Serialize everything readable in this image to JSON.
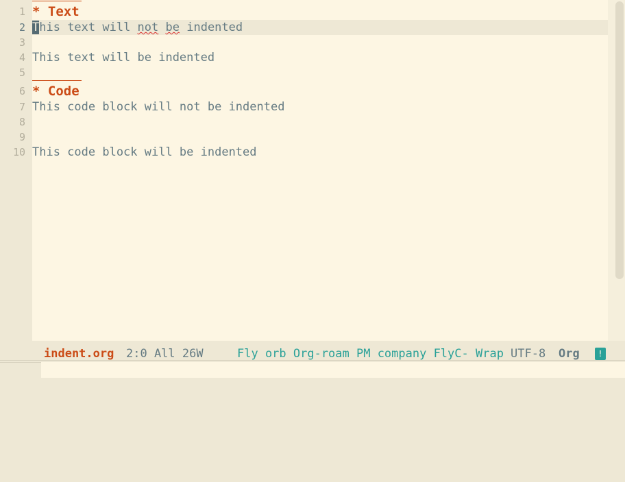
{
  "editor": {
    "lines": [
      {
        "num": "1",
        "text": "* Text",
        "kind": "heading"
      },
      {
        "num": "2",
        "cursor_char": "T",
        "segments": [
          "his text will ",
          "not",
          " ",
          "be",
          " indented"
        ],
        "kind": "current"
      },
      {
        "num": "3",
        "text": "",
        "kind": "plain"
      },
      {
        "num": "4",
        "text": "This text will be indented",
        "kind": "plain"
      },
      {
        "num": "5",
        "text": "",
        "kind": "plain"
      },
      {
        "num": "6",
        "text": "* Code",
        "kind": "heading"
      },
      {
        "num": "7",
        "text": "This code block will not be indented",
        "kind": "plain"
      },
      {
        "num": "8",
        "text": "",
        "kind": "plain"
      },
      {
        "num": "9",
        "text": "",
        "kind": "plain"
      },
      {
        "num": "10",
        "text": "This code block will be indented",
        "kind": "plain"
      }
    ]
  },
  "modeline": {
    "evil_state_icon": "evil-state-icon",
    "save_icon": "floppy-disk-icon",
    "buffer_name": "indent.org",
    "position": "2:0 All 26W",
    "minor_modes": "Fly orb Org-roam PM company FlyC- Wrap",
    "encoding": "UTF-8",
    "major_mode": "Org",
    "flycheck_indicator": "!"
  },
  "colors": {
    "background": "#fdf6e3",
    "fringe": "#eee8d5",
    "text": "#657b83",
    "heading": "#cb4b16",
    "minor_modes": "#2aa198",
    "spell_error": "#dc322f"
  }
}
